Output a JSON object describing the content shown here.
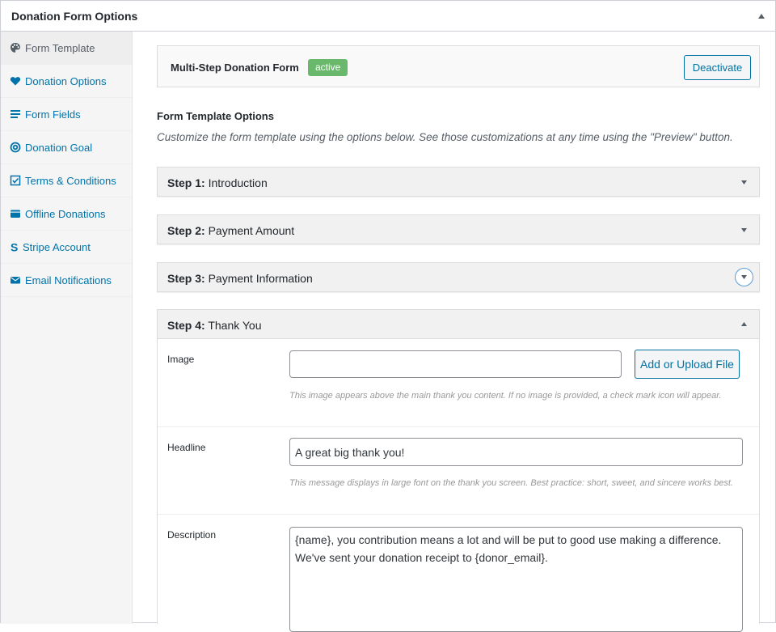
{
  "metabox": {
    "title": "Donation Form Options"
  },
  "sidebar": {
    "items": [
      {
        "label": "Form Template",
        "icon": "palette-icon",
        "active": true
      },
      {
        "label": "Donation Options",
        "icon": "heart-icon"
      },
      {
        "label": "Form Fields",
        "icon": "list-icon"
      },
      {
        "label": "Donation Goal",
        "icon": "target-icon"
      },
      {
        "label": "Terms & Conditions",
        "icon": "checkbox-icon"
      },
      {
        "label": "Offline Donations",
        "icon": "wallet-icon"
      },
      {
        "label": "Stripe Account",
        "icon": "stripe-icon"
      },
      {
        "label": "Email Notifications",
        "icon": "envelope-icon"
      }
    ]
  },
  "template": {
    "name": "Multi-Step Donation Form",
    "status": "active",
    "deactivate_label": "Deactivate"
  },
  "options": {
    "title": "Form Template Options",
    "description": "Customize the form template using the options below. See those customizations at any time using the \"Preview\" button."
  },
  "steps": [
    {
      "number": "Step 1:",
      "name": "Introduction",
      "state": "collapsed"
    },
    {
      "number": "Step 2:",
      "name": "Payment Amount",
      "state": "collapsed"
    },
    {
      "number": "Step 3:",
      "name": "Payment Information",
      "state": "collapsed-focused"
    },
    {
      "number": "Step 4:",
      "name": "Thank You",
      "state": "expanded"
    }
  ],
  "thank_you": {
    "image": {
      "label": "Image",
      "value": "",
      "button_label": "Add or Upload File",
      "help": "This image appears above the main thank you content. If no image is provided, a check mark icon will appear."
    },
    "headline": {
      "label": "Headline",
      "value": "A great big thank you!",
      "help": "This message displays in large font on the thank you screen. Best practice: short, sweet, and sincere works best."
    },
    "description": {
      "label": "Description",
      "value": "{name}, you contribution means a lot and will be put to good use making a difference. We've sent your donation receipt to {donor_email}."
    }
  },
  "colors": {
    "link": "#0073aa",
    "badge": "#69b86b",
    "button_border": "#0071a1",
    "focus_ring": "#5b9dd9"
  }
}
